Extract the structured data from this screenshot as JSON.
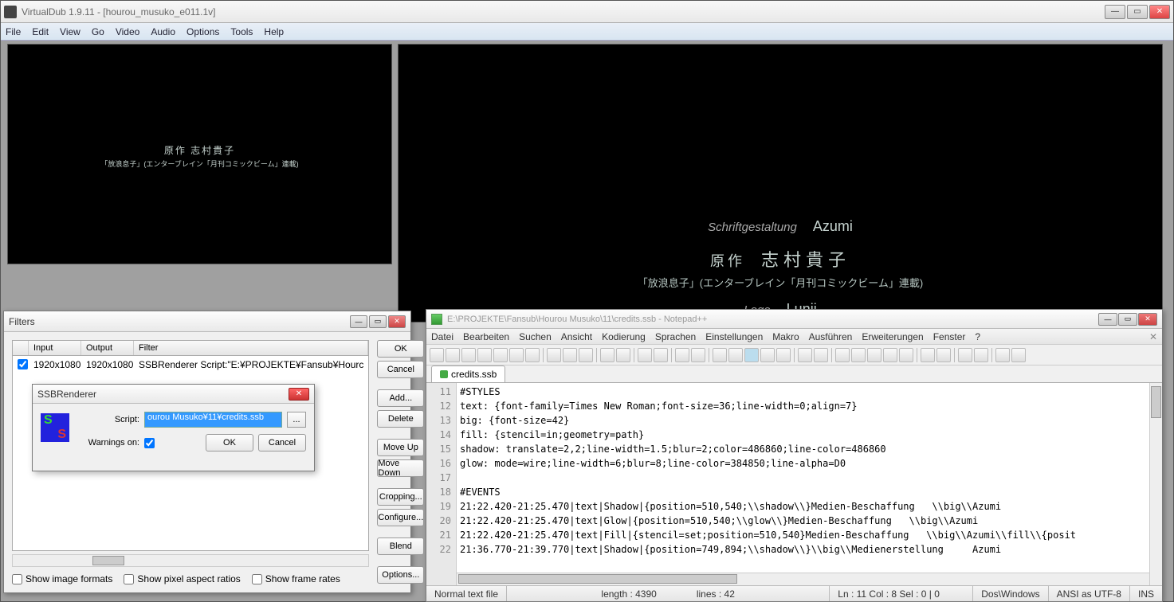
{
  "main": {
    "title": "VirtualDub 1.9.11 - [hourou_musuko_e011.1v]",
    "menu": [
      "File",
      "Edit",
      "View",
      "Go",
      "Video",
      "Audio",
      "Options",
      "Tools",
      "Help"
    ]
  },
  "video_left": {
    "line1": "原作  志村貴子",
    "line2": "「放浪息子」(エンターブレイン「月刊コミックビーム」連載)"
  },
  "video_right": {
    "row1_l": "Schriftgestaltung",
    "row1_r": "Azumi",
    "row2_l": "原作",
    "row2_r": "志村貴子",
    "row2_sub": "「放浪息子」(エンターブレイン「月刊コミックビーム」連載)",
    "row3_l": "Logo",
    "row3_r": "Lunji"
  },
  "filters": {
    "title": "Filters",
    "headers": {
      "input": "Input",
      "output": "Output",
      "filter": "Filter"
    },
    "row": {
      "input": "1920x1080",
      "output": "1920x1080",
      "filter": "SSBRenderer Script:\"E:¥PROJEKTE¥Fansub¥Hourc"
    },
    "checks": {
      "img": "Show image formats",
      "par": "Show pixel aspect ratios",
      "fr": "Show frame rates"
    },
    "buttons": {
      "ok": "OK",
      "cancel": "Cancel",
      "add": "Add...",
      "delete": "Delete",
      "moveup": "Move Up",
      "movedown": "Move Down",
      "cropping": "Cropping...",
      "configure": "Configure...",
      "blend": "Blend",
      "options": "Options..."
    }
  },
  "ssb": {
    "title": "SSBRenderer",
    "script_label": "Script:",
    "script_value": "ourou Musuko¥11¥credits.ssb",
    "browse": "...",
    "warn_label": "Warnings on:",
    "ok": "OK",
    "cancel": "Cancel"
  },
  "npp": {
    "title": "E:\\PROJEKTE\\Fansub\\Hourou Musuko\\11\\credits.ssb - Notepad++",
    "menu": [
      "Datei",
      "Bearbeiten",
      "Suchen",
      "Ansicht",
      "Kodierung",
      "Sprachen",
      "Einstellungen",
      "Makro",
      "Ausführen",
      "Erweiterungen",
      "Fenster",
      "?"
    ],
    "tab": "credits.ssb",
    "lines": [
      "#STYLES",
      "text: {font-family=Times New Roman;font-size=36;line-width=0;align=7}",
      "big: {font-size=42}",
      "fill: {stencil=in;geometry=path}",
      "shadow: translate=2,2;line-width=1.5;blur=2;color=486860;line-color=486860",
      "glow: mode=wire;line-width=6;blur=8;line-color=384850;line-alpha=D0",
      "",
      "#EVENTS",
      "21:22.420-21:25.470|text|Shadow|{position=510,540;\\\\shadow\\\\}Medien-Beschaffung   \\\\big\\\\Azumi",
      "21:22.420-21:25.470|text|Glow|{position=510,540;\\\\glow\\\\}Medien-Beschaffung   \\\\big\\\\Azumi",
      "21:22.420-21:25.470|text|Fill|{stencil=set;position=510,540}Medien-Beschaffung   \\\\big\\\\Azumi\\\\fill\\\\{posit",
      "21:36.770-21:39.770|text|Shadow|{position=749,894;\\\\shadow\\\\}\\\\big\\\\Medienerstellung     Azumi"
    ],
    "linenumbers": [
      "11",
      "12",
      "13",
      "14",
      "15",
      "16",
      "17",
      "18",
      "19",
      "20",
      "21",
      "22"
    ],
    "status": {
      "mode": "Normal text file",
      "len": "length : 4390",
      "lines": "lines : 42",
      "pos": "Ln : 11    Col : 8    Sel : 0 | 0",
      "eol": "Dos\\Windows",
      "enc": "ANSI as UTF-8",
      "ins": "INS"
    }
  }
}
